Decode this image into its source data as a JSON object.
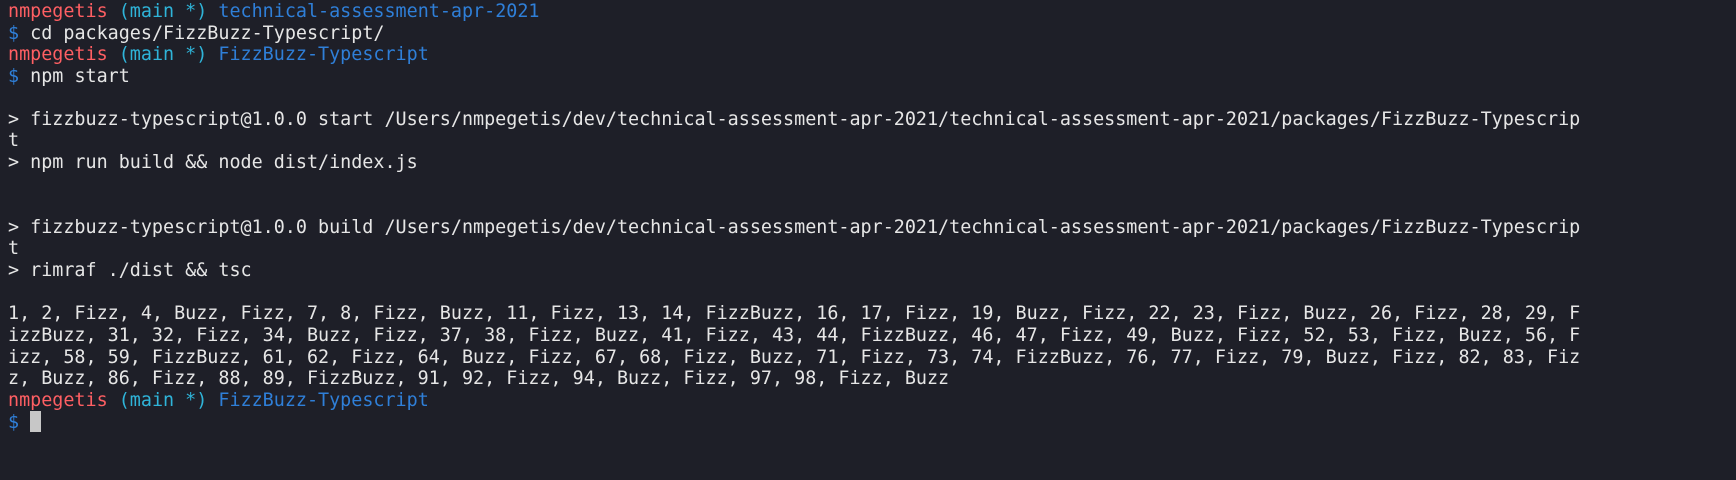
{
  "colors": {
    "background": "#1e1f28",
    "user": "#ff5f63",
    "branch": "#2fb4d9",
    "directory": "#2f7fd8",
    "text": "#e6e6e6",
    "cursor": "#c7c7c7"
  },
  "prompt": {
    "user": "nmpegetis",
    "branch": "(main *)",
    "symbol": "$"
  },
  "session": {
    "prompt1_dir": "technical-assessment-apr-2021",
    "command1": "cd packages/FizzBuzz-Typescript/",
    "prompt2_dir": "FizzBuzz-Typescript",
    "command2": "npm start",
    "start_line1": "> fizzbuzz-typescript@1.0.0 start /Users/nmpegetis/dev/technical-assessment-apr-2021/technical-assessment-apr-2021/packages/FizzBuzz-Typescrip",
    "start_line1_wrap": "t",
    "start_line2": "> npm run build && node dist/index.js",
    "build_line1": "> fizzbuzz-typescript@1.0.0 build /Users/nmpegetis/dev/technical-assessment-apr-2021/technical-assessment-apr-2021/packages/FizzBuzz-Typescrip",
    "build_line1_wrap": "t",
    "build_line2": "> rimraf ./dist && tsc",
    "output": [
      "1, 2, Fizz, 4, Buzz, Fizz, 7, 8, Fizz, Buzz, 11, Fizz, 13, 14, FizzBuzz, 16, 17, Fizz, 19, Buzz, Fizz, 22, 23, Fizz, Buzz, 26, Fizz, 28, 29, F",
      "izzBuzz, 31, 32, Fizz, 34, Buzz, Fizz, 37, 38, Fizz, Buzz, 41, Fizz, 43, 44, FizzBuzz, 46, 47, Fizz, 49, Buzz, Fizz, 52, 53, Fizz, Buzz, 56, F",
      "izz, 58, 59, FizzBuzz, 61, 62, Fizz, 64, Buzz, Fizz, 67, 68, Fizz, Buzz, 71, Fizz, 73, 74, FizzBuzz, 76, 77, Fizz, 79, Buzz, Fizz, 82, 83, Fiz",
      "z, Buzz, 86, Fizz, 88, 89, FizzBuzz, 91, 92, Fizz, 94, Buzz, Fizz, 97, 98, Fizz, Buzz"
    ],
    "prompt3_dir": "FizzBuzz-Typescript"
  }
}
